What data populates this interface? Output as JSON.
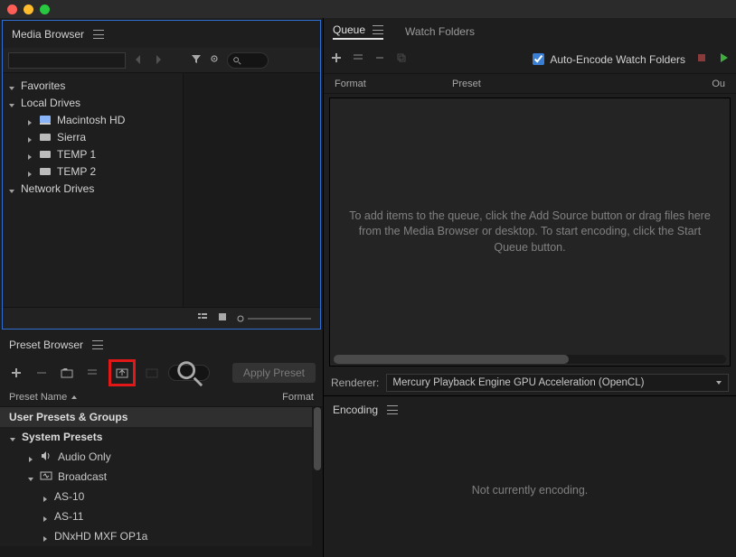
{
  "titlebar": {
    "dots": [
      "red",
      "yellow",
      "green"
    ]
  },
  "media_browser": {
    "title": "Media Browser",
    "tree": {
      "favorites": "Favorites",
      "local_drives": "Local Drives",
      "drives": [
        {
          "label": "Macintosh HD"
        },
        {
          "label": "Sierra"
        },
        {
          "label": "TEMP 1"
        },
        {
          "label": "TEMP 2"
        }
      ],
      "network_drives": "Network Drives"
    }
  },
  "preset_browser": {
    "title": "Preset Browser",
    "apply_label": "Apply Preset",
    "col_name": "Preset Name",
    "col_format": "Format",
    "user_presets": "User Presets & Groups",
    "system_presets": "System Presets",
    "categories": [
      {
        "icon": "audio",
        "label": "Audio Only"
      },
      {
        "icon": "video",
        "label": "Broadcast"
      }
    ],
    "broadcast_children": [
      {
        "label": "AS-10"
      },
      {
        "label": "AS-11"
      },
      {
        "label": "DNxHD MXF OP1a"
      }
    ]
  },
  "queue": {
    "tab_queue": "Queue",
    "tab_watch": "Watch Folders",
    "auto_encode": "Auto-Encode Watch Folders",
    "col_format": "Format",
    "col_preset": "Preset",
    "col_output": "Ou",
    "placeholder": "To add items to the queue, click the Add Source button or drag files here from the Media Browser or desktop.  To start encoding, click the Start Queue button.",
    "renderer_label": "Renderer:",
    "renderer_value": "Mercury Playback Engine GPU Acceleration (OpenCL)"
  },
  "encoding": {
    "title": "Encoding",
    "placeholder": "Not currently encoding."
  }
}
